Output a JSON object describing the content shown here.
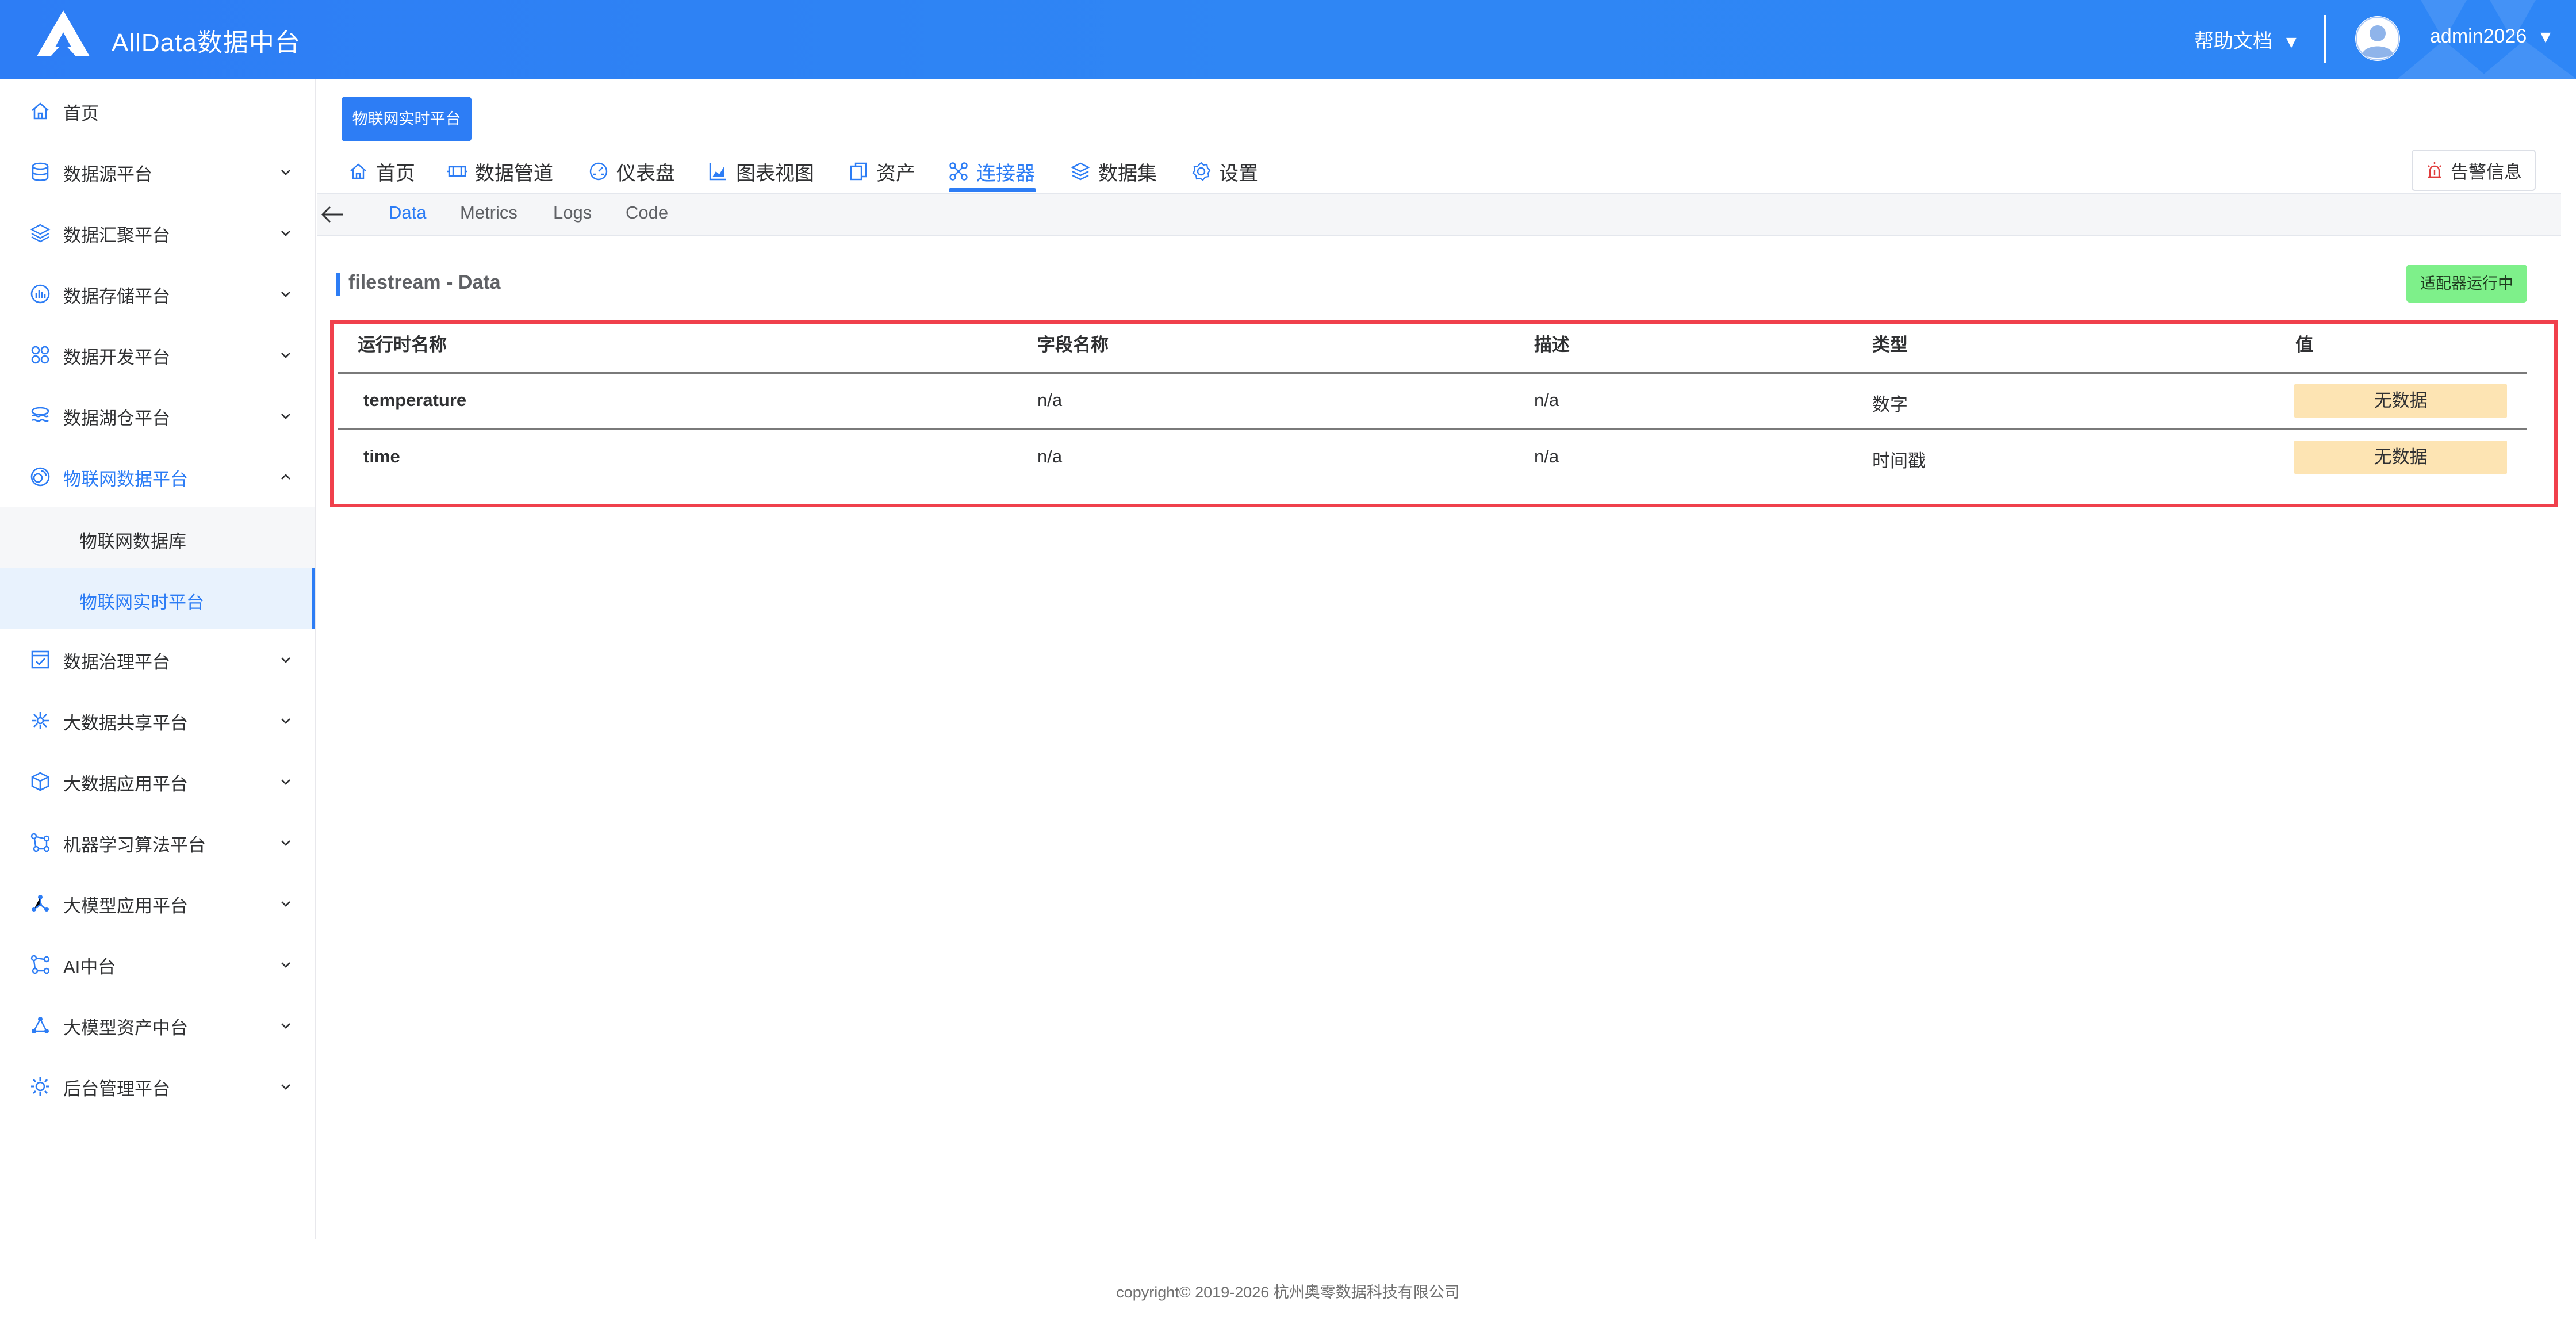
{
  "header": {
    "app_title": "AllData数据中台",
    "help_docs": "帮助文档",
    "username": "admin2026",
    "caret": "▼",
    "colors": {
      "header_bg": "#2d7df5",
      "accent": "#2d7df5"
    }
  },
  "sidebar": {
    "items": [
      {
        "label": "首页",
        "icon": "home-icon"
      },
      {
        "label": "数据源平台",
        "icon": "database-icon"
      },
      {
        "label": "数据汇聚平台",
        "icon": "layers-icon"
      },
      {
        "label": "数据存储平台",
        "icon": "storage-chart-icon"
      },
      {
        "label": "数据开发平台",
        "icon": "grid-apps-icon"
      },
      {
        "label": "数据湖仓平台",
        "icon": "lake-icon"
      },
      {
        "label": "物联网数据平台",
        "icon": "iot-icon",
        "expanded": true
      },
      {
        "label": "数据治理平台",
        "icon": "governance-icon"
      },
      {
        "label": "大数据共享平台",
        "icon": "share-icon"
      },
      {
        "label": "大数据应用平台",
        "icon": "cube-icon"
      },
      {
        "label": "机器学习算法平台",
        "icon": "ml-icon"
      },
      {
        "label": "大模型应用平台",
        "icon": "model-app-icon"
      },
      {
        "label": "AI中台",
        "icon": "ai-icon"
      },
      {
        "label": "大模型资产中台",
        "icon": "model-asset-icon"
      },
      {
        "label": "后台管理平台",
        "icon": "admin-gear-icon"
      }
    ],
    "sub_items": [
      {
        "label": "物联网数据库"
      },
      {
        "label": "物联网实时平台",
        "selected": true
      }
    ]
  },
  "main": {
    "page_tag": "物联网实时平台",
    "tabs": [
      {
        "label": "首页",
        "icon": "home-icon"
      },
      {
        "label": "数据管道",
        "icon": "pipeline-icon"
      },
      {
        "label": "仪表盘",
        "icon": "dashboard-icon"
      },
      {
        "label": "图表视图",
        "icon": "chart-icon"
      },
      {
        "label": "资产",
        "icon": "asset-icon"
      },
      {
        "label": "连接器",
        "icon": "connector-icon",
        "active": true
      },
      {
        "label": "数据集",
        "icon": "dataset-icon"
      },
      {
        "label": "设置",
        "icon": "settings-icon"
      }
    ],
    "alert_button": "告警信息",
    "sub_tabs": [
      {
        "label": "Data",
        "active": true
      },
      {
        "label": "Metrics"
      },
      {
        "label": "Logs"
      },
      {
        "label": "Code"
      }
    ],
    "section_title": "filestream - Data",
    "status_badge": "适配器运行中",
    "table": {
      "headers": [
        "运行时名称",
        "字段名称",
        "描述",
        "类型",
        "值"
      ],
      "rows": [
        {
          "runtime_name": "temperature",
          "field_name": "n/a",
          "description": "n/a",
          "type": "数字",
          "value": "无数据"
        },
        {
          "runtime_name": "time",
          "field_name": "n/a",
          "description": "n/a",
          "type": "时间戳",
          "value": "无数据"
        }
      ]
    }
  },
  "footer": {
    "copyright": "copyright© 2019-2026 杭州奥零数据科技有限公司"
  }
}
